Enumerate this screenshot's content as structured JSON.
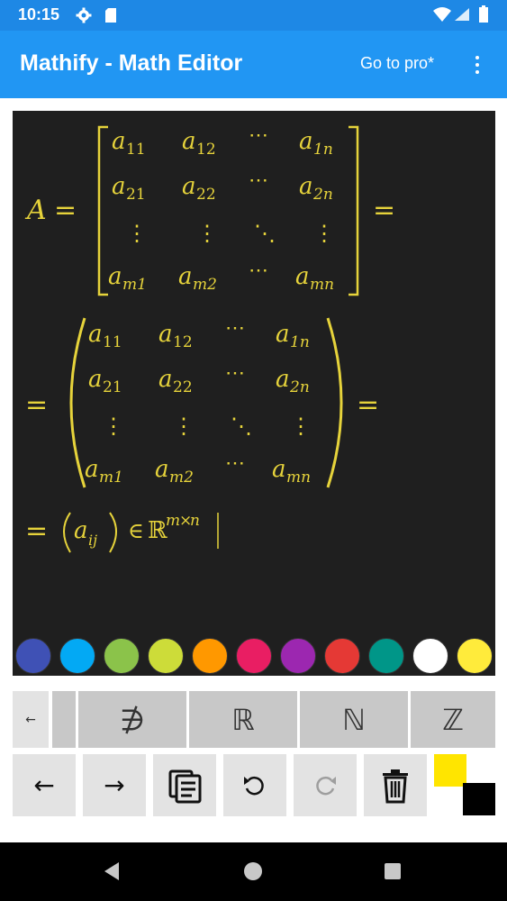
{
  "status_bar": {
    "time": "10:15",
    "icons": [
      "gear-icon",
      "sd-card-icon",
      "wifi-icon",
      "signal-icon",
      "battery-icon"
    ]
  },
  "app_bar": {
    "title": "Mathify - Math Editor",
    "go_pro_label": "Go to pro*",
    "overflow_icon": "more-vert-icon",
    "background": "#2196f3"
  },
  "editor": {
    "background": "#1f1f1f",
    "text_color": "#e6d33b",
    "lines": {
      "lhs": "A",
      "equals": "=",
      "elements_in": "∈",
      "reals_sup": "ℝ",
      "sup_m": "m",
      "sup_times": "×",
      "sup_n": "n",
      "general_term": "a",
      "general_sub": "ij"
    },
    "matrix": {
      "entry_base": "a",
      "rows": [
        [
          "11",
          "12",
          "⋯",
          "1n"
        ],
        [
          "21",
          "22",
          "⋯",
          "2n"
        ],
        [
          "⋮",
          "⋮",
          "⋱",
          "⋮"
        ],
        [
          "m1",
          "m2",
          "⋯",
          "mn"
        ]
      ]
    }
  },
  "palette": {
    "colors": [
      "#3f51b5",
      "#03a9f4",
      "#8bc34a",
      "#cddc39",
      "#ff9800",
      "#e91e63",
      "#9c27b0",
      "#e53935",
      "#009688",
      "#ffffff",
      "#ffeb3b"
    ]
  },
  "symbol_keys": [
    {
      "label": "←",
      "name": "scroll-left-key"
    },
    {
      "label": "",
      "name": "hidden-symbol-key"
    },
    {
      "label": "∌",
      "name": "not-contains-key"
    },
    {
      "label": "ℝ",
      "name": "reals-key"
    },
    {
      "label": "ℕ",
      "name": "naturals-key"
    },
    {
      "label": "ℤ",
      "name": "integers-key"
    }
  ],
  "controls": {
    "left_label": "←",
    "right_label": "→",
    "icons": [
      "arrow-left-icon",
      "arrow-right-icon",
      "clipboard-icon",
      "undo-icon",
      "redo-icon",
      "trash-icon"
    ],
    "foreground_color": "#ffe500",
    "background_color": "#000000"
  },
  "nav_bar": {
    "icons": [
      "back-icon",
      "home-icon",
      "recents-icon"
    ]
  }
}
